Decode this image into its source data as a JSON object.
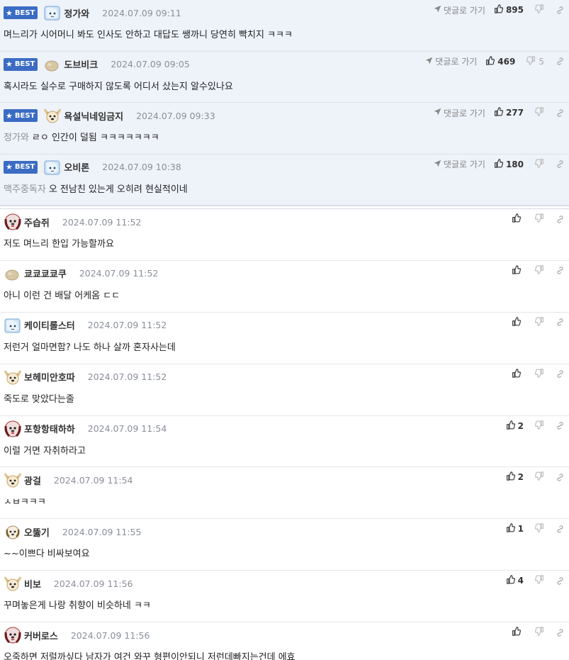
{
  "labels": {
    "best_badge": "BEST",
    "goto_comment": "댓글로 가기"
  },
  "colors": {
    "best_bg": "#eef2f9",
    "badge": "#3b6cc4"
  },
  "comments": [
    {
      "best": true,
      "avatar": "ice-cube",
      "nick": "정가와",
      "date": "2024.07.09 09:11",
      "reply_to": "",
      "text": "며느리가 시어머니 봐도 인사도 안하고 대답도 쌩까니 당연히 빡치지 ㅋㅋㅋ",
      "likes": "895",
      "dislikes": ""
    },
    {
      "best": true,
      "avatar": "potato",
      "nick": "도브비크",
      "date": "2024.07.09 09:05",
      "reply_to": "",
      "text": "혹시라도 실수로 구매하지 않도록 어디서 샀는지 알수있나요",
      "likes": "469",
      "dislikes": "5"
    },
    {
      "best": true,
      "avatar": "dog-face",
      "nick": "욕설닉네임금지",
      "date": "2024.07.09 09:33",
      "reply_to": "정가와",
      "text": "ㄹㅇ 인간이 덜됨 ㅋㅋㅋㅋㅋㅋㅋ",
      "likes": "277",
      "dislikes": ""
    },
    {
      "best": true,
      "avatar": "ice-cube",
      "nick": "오비론",
      "date": "2024.07.09 10:38",
      "reply_to": "맥주중독자",
      "text": "오 전남친 있는게 오히려 현실적이네",
      "likes": "180",
      "dislikes": ""
    },
    {
      "best": false,
      "avatar": "puppy-red",
      "nick": "주습쥐",
      "date": "2024.07.09 11:52",
      "reply_to": "",
      "text": "저도 며느리 한입 가능할까요",
      "likes": "",
      "dislikes": ""
    },
    {
      "best": false,
      "avatar": "potato",
      "nick": "쿄쿄쿄쿄쿠",
      "date": "2024.07.09 11:52",
      "reply_to": "",
      "text": "아니 이런 건 배달 어케옴 ㄷㄷ",
      "likes": "",
      "dislikes": ""
    },
    {
      "best": false,
      "avatar": "ice-cube",
      "nick": "케이티롤스터",
      "date": "2024.07.09 11:52",
      "reply_to": "",
      "text": "저런거 얼마면함? 나도 하나 살까 혼자사는데",
      "likes": "",
      "dislikes": ""
    },
    {
      "best": false,
      "avatar": "dog-face",
      "nick": "보헤미안호따",
      "date": "2024.07.09 11:52",
      "reply_to": "",
      "text": "죽도로 맞았다는줄",
      "likes": "",
      "dislikes": ""
    },
    {
      "best": false,
      "avatar": "puppy-red",
      "nick": "포항항태하하",
      "date": "2024.07.09 11:54",
      "reply_to": "",
      "text": "이럴 거면 자취하라고",
      "likes": "2",
      "dislikes": ""
    },
    {
      "best": false,
      "avatar": "dog-face",
      "nick": "광걸",
      "date": "2024.07.09 11:54",
      "reply_to": "",
      "text": "ㅅㅂㅋㅋㅋ",
      "likes": "2",
      "dislikes": ""
    },
    {
      "best": false,
      "avatar": "puppy-small",
      "nick": "오뚫기",
      "date": "2024.07.09 11:55",
      "reply_to": "",
      "text": "~~이쁘다 비싸보여요",
      "likes": "1",
      "dislikes": ""
    },
    {
      "best": false,
      "avatar": "dog-face",
      "nick": "비보",
      "date": "2024.07.09 11:56",
      "reply_to": "",
      "text": "꾸며놓은게 나랑 취향이 비슷하네 ㅋㅋ",
      "likes": "4",
      "dislikes": ""
    },
    {
      "best": false,
      "avatar": "puppy-red",
      "nick": "커버로스",
      "date": "2024.07.09 11:56",
      "reply_to": "",
      "text": "오죽하면 저럴까싶다 남자가 여건 와꾸 형편이안되니 저런데빠지는건데 에효",
      "likes": "",
      "dislikes": ""
    }
  ]
}
